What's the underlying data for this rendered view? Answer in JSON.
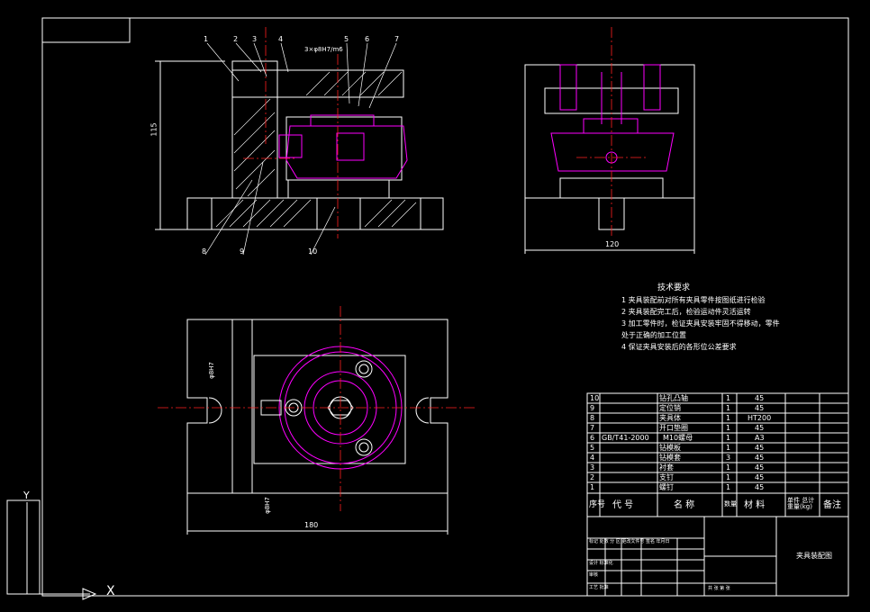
{
  "colors": {
    "background": "#000000",
    "line": "#ffffff",
    "centerline": "#ff2020",
    "part": "#ff00ff",
    "dimension": "#ffffff",
    "hatch": "#ffffff"
  },
  "part_labels": [
    "1",
    "2",
    "3",
    "4",
    "5",
    "6",
    "7",
    "8",
    "9",
    "10"
  ],
  "dimensions": {
    "height_115": "115",
    "width_120": "120",
    "width_180": "180",
    "fit_top": "3×φ8H7/m6",
    "fit_left": "φ8H7",
    "fit_bottom": "φ8H7"
  },
  "tech_requirements": {
    "title": "技术要求",
    "items": [
      "1   夹具装配前对所有夹具零件按图纸进行检验",
      "2   夹具装配完工后，检验运动件灵活运转",
      "3   加工零件时，检证夹具安装牢固不得移动，零件",
      "      处于正确的加工位置",
      "4   保证夹具安装后的各形位公差要求"
    ]
  },
  "bom": {
    "rows": [
      {
        "no": "10",
        "code": "",
        "name": "钻孔凸轴",
        "qty": "1",
        "material": "45"
      },
      {
        "no": "9",
        "code": "",
        "name": "定位销",
        "qty": "1",
        "material": "45"
      },
      {
        "no": "8",
        "code": "",
        "name": "夹具体",
        "qty": "1",
        "material": "HT200"
      },
      {
        "no": "7",
        "code": "",
        "name": "开口垫圈",
        "qty": "1",
        "material": "45"
      },
      {
        "no": "6",
        "code": "GB/T41-2000",
        "name": "M10螺母",
        "qty": "1",
        "material": "A3"
      },
      {
        "no": "5",
        "code": "",
        "name": "钻模板",
        "qty": "1",
        "material": "45"
      },
      {
        "no": "4",
        "code": "",
        "name": "钻模套",
        "qty": "3",
        "material": "45"
      },
      {
        "no": "3",
        "code": "",
        "name": "衬套",
        "qty": "1",
        "material": "45"
      },
      {
        "no": "2",
        "code": "",
        "name": "支钉",
        "qty": "1",
        "material": "45"
      },
      {
        "no": "1",
        "code": "",
        "name": "螺钉",
        "qty": "1",
        "material": "45"
      }
    ],
    "header": {
      "no": "序号",
      "code": "代  号",
      "name": "名  称",
      "qty": "数量",
      "material": "材  料",
      "weight": "单件 总计 重量(kg)",
      "note": "备注"
    }
  },
  "title_block": {
    "drawing_name": "夹具装配图",
    "rows": [
      "标记 处数 分 区 更改文件号 签名 年月日",
      "设计          标准化",
      "审核",
      "工艺          批准"
    ],
    "footer": "共   张  第   张"
  },
  "ucs": {
    "x_label": "X",
    "y_label": "Y"
  }
}
